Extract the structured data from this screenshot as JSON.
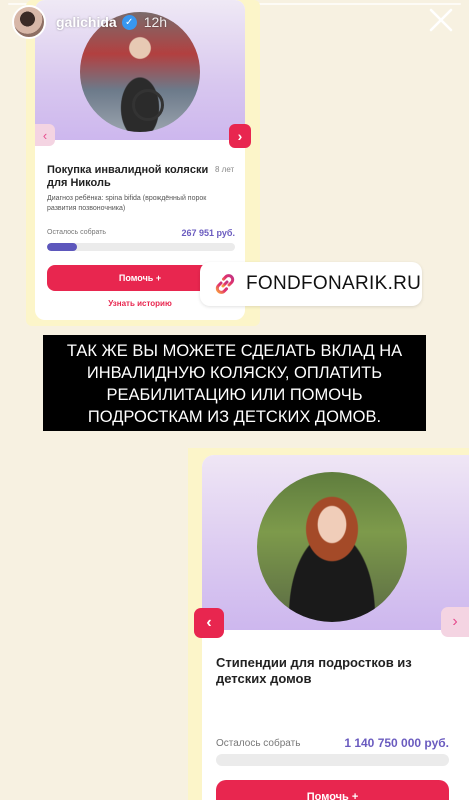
{
  "story": {
    "username": "galichida",
    "time": "12h",
    "verified_icon": "verified-badge-icon",
    "close_icon": "close-icon"
  },
  "card1": {
    "title": "Покупка инвалидной коляски для Николь",
    "age": "8 лет",
    "diagnosis": "Диагноз ребёнка: spina bifida (врождённый порок развития позвоночника)",
    "remaining_label": "Осталось собрать",
    "amount": "267 951 руб.",
    "progress": 0.16,
    "help_label": "Помочь +",
    "story_link": "Узнать историю",
    "prev_arrow": "‹",
    "next_arrow": "›"
  },
  "link_sticker": {
    "icon": "link-icon",
    "text": "FONDFONARIK.RU"
  },
  "caption": {
    "lines": [
      "ТАК ЖЕ ВЫ МОЖЕТЕ СДЕЛАТЬ ВКЛАД НА",
      "ИНВАЛИДНУЮ КОЛЯСКУ, ОПЛАТИТЬ",
      "РЕАБИЛИТАЦИЮ ИЛИ ПОМОЧЬ",
      "ПОДРОСТКАМ ИЗ ДЕТСКИХ ДОМОВ."
    ]
  },
  "card2": {
    "title": "Стипендии для подростков из детских домов",
    "remaining_label": "Осталось собрать",
    "amount": "1 140 750 000 руб.",
    "progress": 0.0,
    "help_label": "Помочь +",
    "prev_arrow": "‹",
    "next_arrow": "›"
  },
  "colors": {
    "accent_red": "#e8264f",
    "progress_purple": "#5d57bc",
    "card_bg": "#fcf5c9"
  }
}
